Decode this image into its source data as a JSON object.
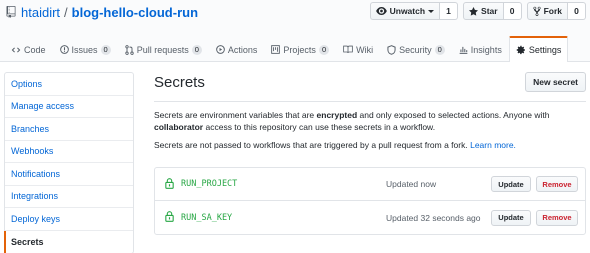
{
  "repo": {
    "owner": "htaidirt",
    "separator": "/",
    "name": "blog-hello-cloud-run"
  },
  "actions": [
    {
      "label": "Unwatch",
      "count": "1",
      "icon": "eye-icon"
    },
    {
      "label": "Star",
      "count": "0",
      "icon": "star-icon"
    },
    {
      "label": "Fork",
      "count": "0",
      "icon": "fork-icon"
    }
  ],
  "tabs": [
    {
      "label": "Code",
      "icon": "code-icon",
      "count": null
    },
    {
      "label": "Issues",
      "icon": "issue-icon",
      "count": "0"
    },
    {
      "label": "Pull requests",
      "icon": "pull-request-icon",
      "count": "0"
    },
    {
      "label": "Actions",
      "icon": "play-icon",
      "count": null
    },
    {
      "label": "Projects",
      "icon": "project-icon",
      "count": "0"
    },
    {
      "label": "Wiki",
      "icon": "book-icon",
      "count": null
    },
    {
      "label": "Security",
      "icon": "shield-icon",
      "count": "0"
    },
    {
      "label": "Insights",
      "icon": "graph-icon",
      "count": null
    },
    {
      "label": "Settings",
      "icon": "gear-icon",
      "count": null,
      "selected": true
    }
  ],
  "sidebar": {
    "items": [
      {
        "label": "Options"
      },
      {
        "label": "Manage access"
      },
      {
        "label": "Branches"
      },
      {
        "label": "Webhooks"
      },
      {
        "label": "Notifications"
      },
      {
        "label": "Integrations"
      },
      {
        "label": "Deploy keys"
      },
      {
        "label": "Secrets",
        "selected": true
      }
    ]
  },
  "main": {
    "title": "Secrets",
    "new_button": "New secret",
    "desc": {
      "part1": "Secrets are environment variables that are ",
      "bold1": "encrypted",
      "part2": " and only exposed to selected actions. Anyone with ",
      "bold2": "collaborator",
      "part3": " access to this repository can use these secrets in a workflow."
    },
    "note": "Secrets are not passed to workflows that are triggered by a pull request from a fork.",
    "learn_more": "Learn more.",
    "secrets": [
      {
        "name": "RUN_PROJECT",
        "updated": "Updated now",
        "update_label": "Update",
        "remove_label": "Remove"
      },
      {
        "name": "RUN_SA_KEY",
        "updated": "Updated 32 seconds ago",
        "update_label": "Update",
        "remove_label": "Remove"
      }
    ]
  },
  "colors": {
    "link": "#0366d6",
    "accent": "#e36209",
    "secret_name": "#28a745",
    "danger": "#cb2431"
  }
}
